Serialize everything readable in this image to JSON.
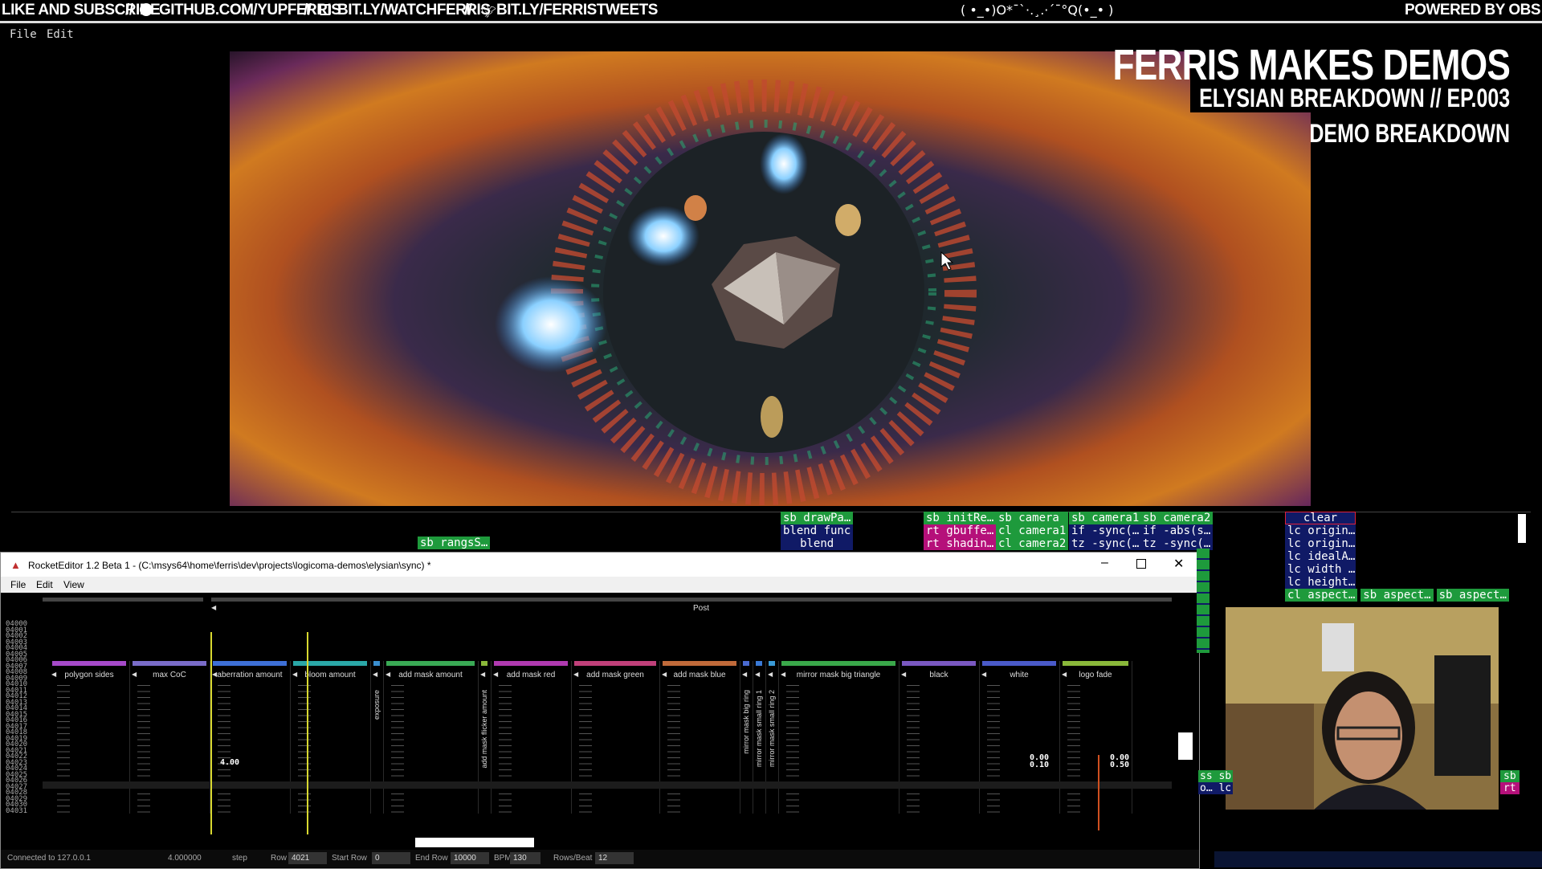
{
  "banner": {
    "left_text": "LIKE AND SUBSCRIBE",
    "github": "GITHUB.COM/YUPFERRIS",
    "twitch": "BIT.LY/WATCHFERRIS",
    "twitter": "BIT.LY/FERRISTWEETS",
    "separator": "//",
    "kaomoji": "( •_•)O*¯`·.¸.·´¯°Q(•_• )",
    "right_text": "POWERED BY OBS"
  },
  "app_menu": [
    "File",
    "Edit"
  ],
  "title_card": {
    "title": "FERRIS MAKES DEMOS",
    "subtitle": "ELYSIAN BREAKDOWN // EP.003",
    "tag": "DEMO BREAKDOWN"
  },
  "profiler": {
    "rangs": "sb rangsS…",
    "col1": [
      "sb drawPa…",
      "blend func",
      "blend"
    ],
    "col2": [
      "sb initRe…",
      "rt gbuffe…",
      "rt shadin…"
    ],
    "col3": [
      "sb camera",
      "cl camera1",
      "cl camera2"
    ],
    "col4": [
      "sb camera1",
      "if -sync(…",
      "tz -sync(…"
    ],
    "col5": [
      "sb camera2",
      "if -abs(s…",
      "tz -sync(…"
    ],
    "col6": [
      "clear",
      "lc origin…",
      "lc origin…",
      "lc idealA…",
      "lc width …",
      "lc height…"
    ],
    "row_aspect": [
      "cl aspect…",
      "sb aspect…",
      "sb aspect…"
    ],
    "colors": {
      "green": "#1e9a3c",
      "navy": "#101a66",
      "pink": "#b5107a",
      "red_outline": "#e0203a"
    }
  },
  "rocket": {
    "title": "RocketEditor 1.2 Beta 1 - (C:\\msys64\\home\\ferris\\dev\\projects\\logicoma-demos\\elysian\\sync) *",
    "menu": [
      "File",
      "Edit",
      "View"
    ],
    "group_label": "Post",
    "tracks": [
      {
        "label": "polygon sides",
        "color": "#a64ac9",
        "vertical": false
      },
      {
        "label": "max CoC",
        "color": "#7a6cc8",
        "vertical": false
      },
      {
        "label": "aberration amount",
        "color": "#3d6fd6",
        "vertical": false
      },
      {
        "label": "bloom amount",
        "color": "#2aa7a7",
        "vertical": false
      },
      {
        "label": "exposure",
        "color": "#3a8fd0",
        "vertical": true
      },
      {
        "label": "add mask amount",
        "color": "#3aaa55",
        "vertical": false
      },
      {
        "label": "add mask flicker amount",
        "color": "#8ab83a",
        "vertical": true
      },
      {
        "label": "add mask red",
        "color": "#b03ab0",
        "vertical": false
      },
      {
        "label": "add mask green",
        "color": "#c0407a",
        "vertical": false
      },
      {
        "label": "add mask blue",
        "color": "#c06a3a",
        "vertical": false
      },
      {
        "label": "mirror mask big ring",
        "color": "#4a6ad0",
        "vertical": true
      },
      {
        "label": "mirror mask small ring 1",
        "color": "#3a7ad6",
        "vertical": true
      },
      {
        "label": "mirror mask small ring 2",
        "color": "#3a9ad6",
        "vertical": true
      },
      {
        "label": "mirror mask big triangle",
        "color": "#3aa84a",
        "vertical": false
      },
      {
        "label": "black",
        "color": "#7a58c0",
        "vertical": false
      },
      {
        "label": "white",
        "color": "#4a5ac8",
        "vertical": false
      },
      {
        "label": "logo fade",
        "color": "#8ab83a",
        "vertical": false
      }
    ],
    "values": {
      "aberration": "4.00",
      "white_a": "0.00",
      "white_b": "0.10",
      "logo_a": "0.00",
      "logo_b": "0.50"
    },
    "row_numbers": [
      "04000",
      "04001",
      "04002",
      "04003",
      "04004",
      "04005",
      "04006",
      "04007",
      "04008",
      "04009",
      "04010",
      "04011",
      "04012",
      "04013",
      "04014",
      "04015",
      "04016",
      "04017",
      "04018",
      "04019",
      "04020",
      "04021",
      "04022",
      "04023",
      "04024",
      "04025",
      "04026",
      "04027",
      "04028",
      "04029",
      "04030",
      "04031"
    ],
    "status": {
      "connection": "Connected to 127.0.0.1",
      "value": "4.000000",
      "interp": "step",
      "row_label": "Row",
      "row": "4021",
      "start_label": "Start Row",
      "start": "0",
      "end_label": "End Row",
      "end": "10000",
      "bpm_label": "BPM",
      "bpm": "130",
      "rpb_label": "Rows/Beat",
      "rpb": "12"
    }
  },
  "webcam_edge_labels": {
    "left": [
      "ss sb",
      "o… lc"
    ],
    "right": [
      "sb",
      "rt"
    ]
  }
}
